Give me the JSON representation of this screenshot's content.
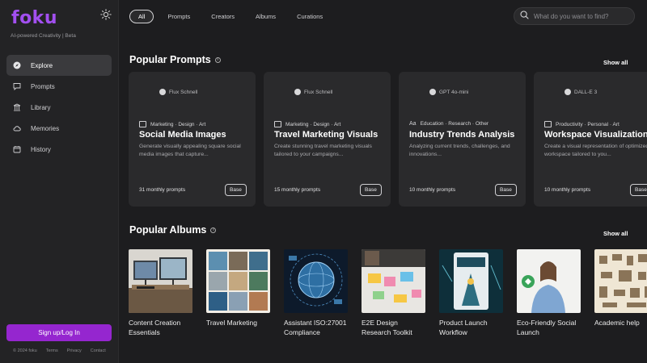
{
  "brand": {
    "logo": "foku",
    "tagline": "AI-powered Creativity | Beta",
    "accent": "#9526cf"
  },
  "sidebar": {
    "items": [
      {
        "label": "Explore",
        "icon": "compass-icon",
        "active": true
      },
      {
        "label": "Prompts",
        "icon": "chat-bubble-icon",
        "active": false
      },
      {
        "label": "Library",
        "icon": "library-icon",
        "active": false
      },
      {
        "label": "Memories",
        "icon": "cloud-icon",
        "active": false
      },
      {
        "label": "History",
        "icon": "calendar-icon",
        "active": false
      }
    ],
    "signup_label": "Sign up/Log In",
    "footer": {
      "copyright": "© 2024 foku",
      "terms": "Terms",
      "privacy": "Privacy",
      "contact": "Contact"
    }
  },
  "topbar": {
    "tabs": [
      "All",
      "Prompts",
      "Creators",
      "Albums",
      "Curations"
    ],
    "active_tab": "All",
    "search_placeholder": "What do you want to find?"
  },
  "prompts_section": {
    "title": "Popular Prompts",
    "show_all": "Show all",
    "cards": [
      {
        "model": "Flux Schnell",
        "tags": "Marketing · Design · Art",
        "title": "Social Media Images",
        "desc": "Generate visually appealing square social media images that capture...",
        "count": "31 monthly prompts",
        "badge": "Base"
      },
      {
        "model": "Flux Schnell",
        "tags": "Marketing · Design · Art",
        "title": "Travel Marketing Visuals",
        "desc": "Create stunning travel marketing visuals tailored to your campaigns...",
        "count": "15 monthly prompts",
        "badge": "Base"
      },
      {
        "model": "GPT 4o-mini",
        "tags": "Education · Research · Other",
        "title": "Industry Trends Analysis",
        "desc": "Analyzing current trends, challenges, and innovations...",
        "count": "10 monthly prompts",
        "badge": "Base"
      },
      {
        "model": "DALL-E 3",
        "tags": "Productivity · Personal · Art",
        "title": "Workspace Visualizations",
        "desc": "Create a visual representation of optimized workspace tailored to you...",
        "count": "10 monthly prompts",
        "badge": "Base"
      }
    ]
  },
  "albums_section": {
    "title": "Popular Albums",
    "show_all": "Show all",
    "albums": [
      {
        "name": "Content Creation Essentials"
      },
      {
        "name": "Travel Marketing"
      },
      {
        "name": "Assistant ISO:27001 Compliance"
      },
      {
        "name": "E2E Design Research Toolkit"
      },
      {
        "name": "Product Launch Workflow"
      },
      {
        "name": "Eco-Friendly Social Launch"
      },
      {
        "name": "Academic help"
      }
    ]
  }
}
